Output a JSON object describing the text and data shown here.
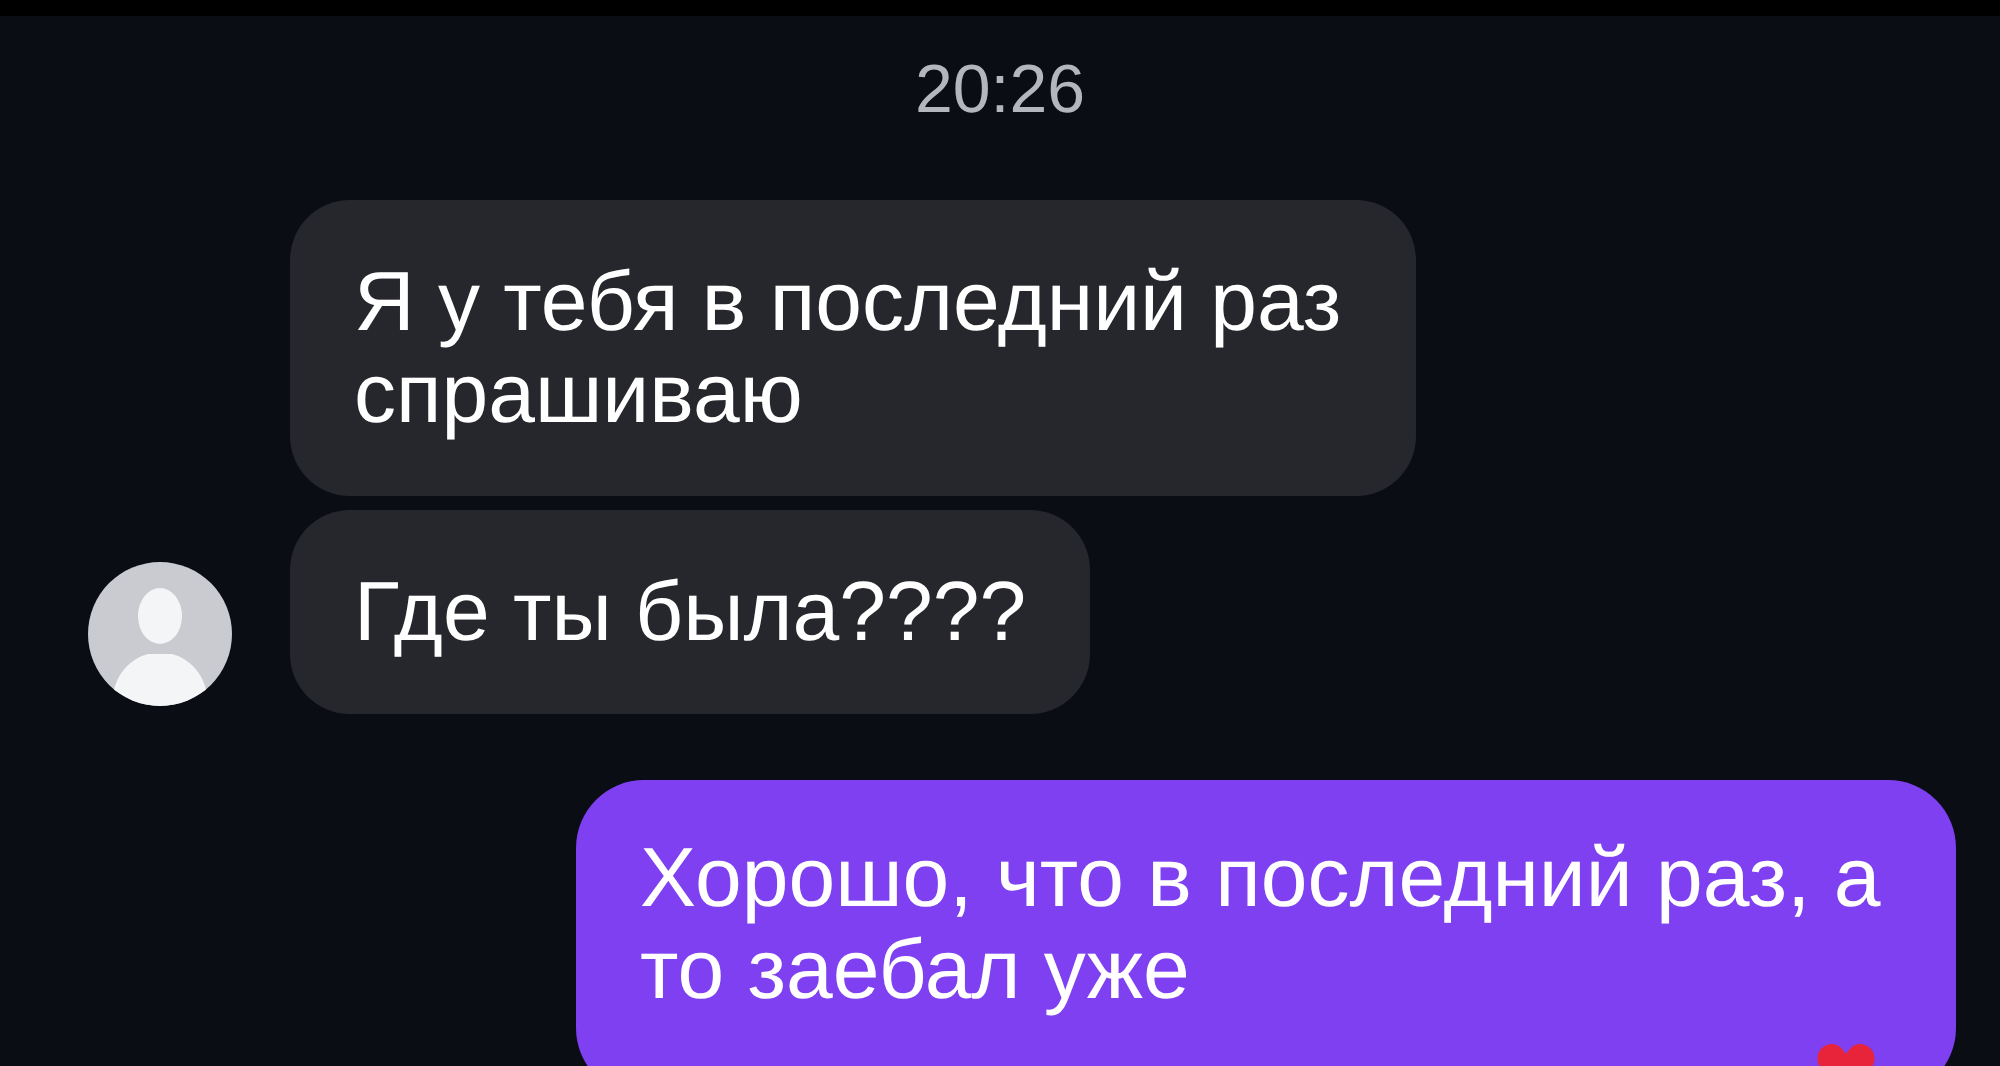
{
  "time": "20:26",
  "messages": [
    {
      "kind": "incoming",
      "text": "Я у тебя в последний раз спрашиваю",
      "avatar": false
    },
    {
      "kind": "incoming",
      "text": "Где ты была????",
      "avatar": true
    },
    {
      "kind": "outgoing",
      "text": "Хорошо, что в последний раз, а то заебал уже",
      "reaction": true
    }
  ]
}
